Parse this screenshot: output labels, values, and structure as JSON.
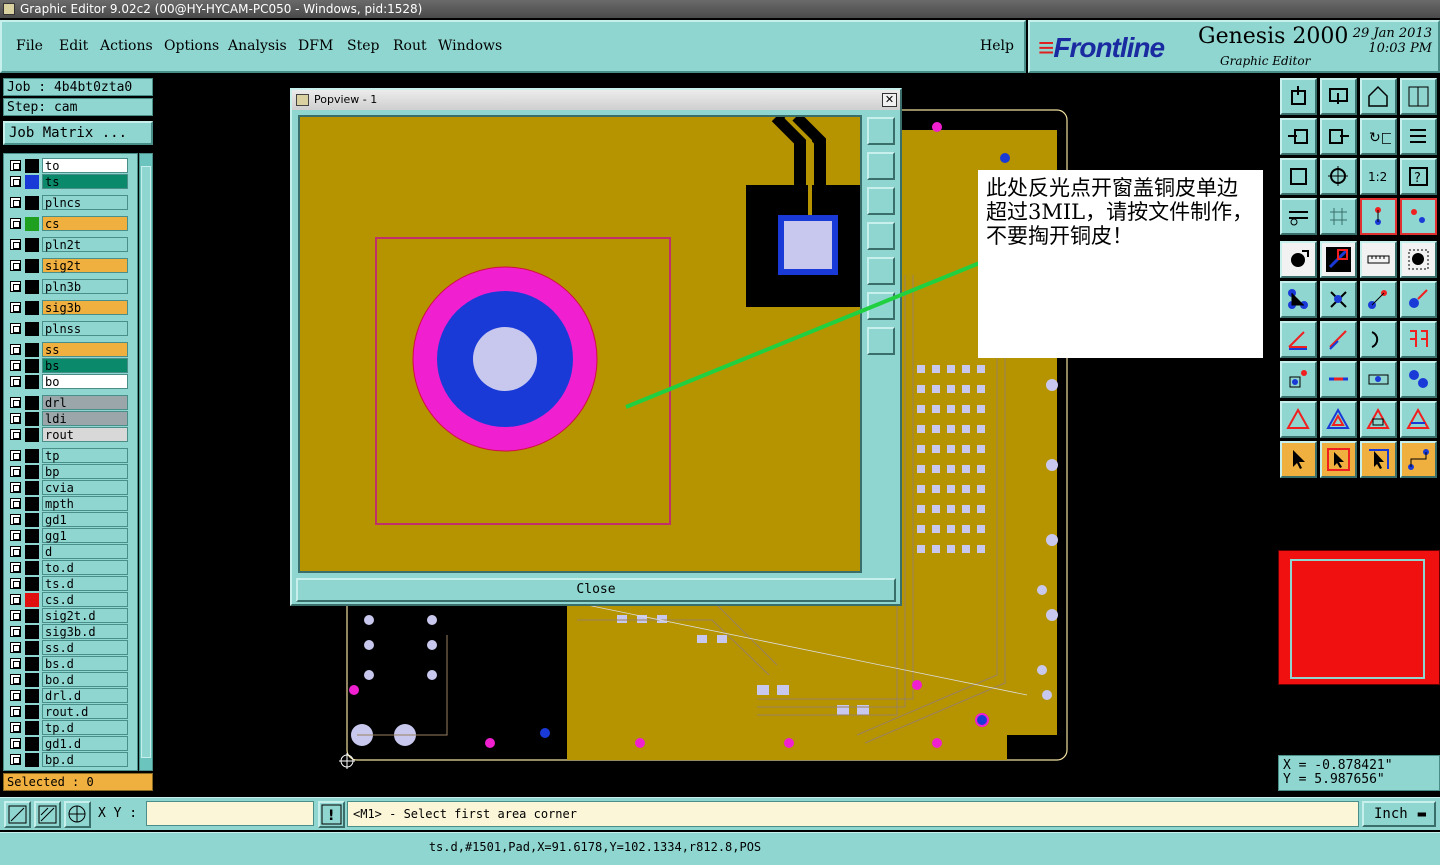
{
  "window": {
    "title": "Graphic Editor 9.02c2 (00@HY-HYCAM-PC050 - Windows, pid:1528)"
  },
  "menu": {
    "items": [
      "File",
      "Edit",
      "Actions",
      "Options",
      "Analysis",
      "DFM",
      "Step",
      "Rout",
      "Windows"
    ],
    "help": "Help"
  },
  "brand": {
    "logo": "Frontline",
    "product": "Genesis 2000",
    "subtitle": "Graphic Editor",
    "date": "29 Jan 2013",
    "time": "10:03 PM"
  },
  "job": {
    "job_label": "Job : 4b4bt0zta0",
    "step_label": "Step: cam",
    "matrix_button": "Job Matrix ..."
  },
  "layers": [
    {
      "name": "to",
      "color": "#ffffff",
      "swatch": "#000000"
    },
    {
      "name": "ts",
      "color": "#0a8a6a",
      "swatch": "#1a3ad8"
    },
    {
      "name": "plncs",
      "color": "#8fd6d0",
      "swatch": "#000000"
    },
    {
      "name": "cs",
      "color": "#f0b040",
      "swatch": "#20a020"
    },
    {
      "name": "pln2t",
      "color": "#8fd6d0",
      "swatch": "#000000"
    },
    {
      "name": "sig2t",
      "color": "#f0b040",
      "swatch": "#000000"
    },
    {
      "name": "pln3b",
      "color": "#8fd6d0",
      "swatch": "#000000"
    },
    {
      "name": "sig3b",
      "color": "#f0b040",
      "swatch": "#000000"
    },
    {
      "name": "plnss",
      "color": "#8fd6d0",
      "swatch": "#000000"
    },
    {
      "name": "ss",
      "color": "#f0b040",
      "swatch": "#000000"
    },
    {
      "name": "bs",
      "color": "#0a8a6a",
      "swatch": "#000000"
    },
    {
      "name": "bo",
      "color": "#ffffff",
      "swatch": "#000000"
    },
    {
      "name": "drl",
      "color": "#9aa6aa",
      "swatch": "#000000"
    },
    {
      "name": "ldi",
      "color": "#9aa6aa",
      "swatch": "#000000"
    },
    {
      "name": "rout",
      "color": "#d8d8d8",
      "swatch": "#000000"
    },
    {
      "name": "tp",
      "color": "#8fd6d0",
      "swatch": "#000000"
    },
    {
      "name": "bp",
      "color": "#8fd6d0",
      "swatch": "#000000"
    },
    {
      "name": "cvia",
      "color": "#8fd6d0",
      "swatch": "#000000"
    },
    {
      "name": "mpth",
      "color": "#8fd6d0",
      "swatch": "#000000"
    },
    {
      "name": "gd1",
      "color": "#8fd6d0",
      "swatch": "#000000"
    },
    {
      "name": "gg1",
      "color": "#8fd6d0",
      "swatch": "#000000"
    },
    {
      "name": "d",
      "color": "#8fd6d0",
      "swatch": "#000000"
    },
    {
      "name": "to.d",
      "color": "#8fd6d0",
      "swatch": "#000000"
    },
    {
      "name": "ts.d",
      "color": "#8fd6d0",
      "swatch": "#000000"
    },
    {
      "name": "cs.d",
      "color": "#8fd6d0",
      "swatch": "#e01010"
    },
    {
      "name": "sig2t.d",
      "color": "#8fd6d0",
      "swatch": "#000000"
    },
    {
      "name": "sig3b.d",
      "color": "#8fd6d0",
      "swatch": "#000000"
    },
    {
      "name": "ss.d",
      "color": "#8fd6d0",
      "swatch": "#000000"
    },
    {
      "name": "bs.d",
      "color": "#8fd6d0",
      "swatch": "#000000"
    },
    {
      "name": "bo.d",
      "color": "#8fd6d0",
      "swatch": "#000000"
    },
    {
      "name": "drl.d",
      "color": "#8fd6d0",
      "swatch": "#000000"
    },
    {
      "name": "rout.d",
      "color": "#8fd6d0",
      "swatch": "#000000"
    },
    {
      "name": "tp.d",
      "color": "#8fd6d0",
      "swatch": "#000000"
    },
    {
      "name": "gd1.d",
      "color": "#8fd6d0",
      "swatch": "#000000"
    },
    {
      "name": "bp.d",
      "color": "#8fd6d0",
      "swatch": "#000000"
    }
  ],
  "selected": "Selected : 0",
  "popview": {
    "title": "Popview - 1",
    "close_label": "Close"
  },
  "annotation": {
    "text": "此处反光点开窗盖铜皮单边超过3MIL，请按文件制作，不要掏开铜皮！"
  },
  "coords": {
    "x": "X = -0.878421\"",
    "y": "Y = 5.987656\""
  },
  "command": {
    "xy_label": "X Y :",
    "message": "<M1> - Select first area corner",
    "units": "Inch"
  },
  "status": {
    "text": "ts.d,#1501,Pad,X=91.6178,Y=102.1334,r812.8,POS"
  },
  "colors": {
    "panel": "#8fd6d0",
    "board": "#b59400",
    "pad": "#1a3ad8",
    "mask_ring": "#f020d0",
    "highlight": "#20d040"
  }
}
